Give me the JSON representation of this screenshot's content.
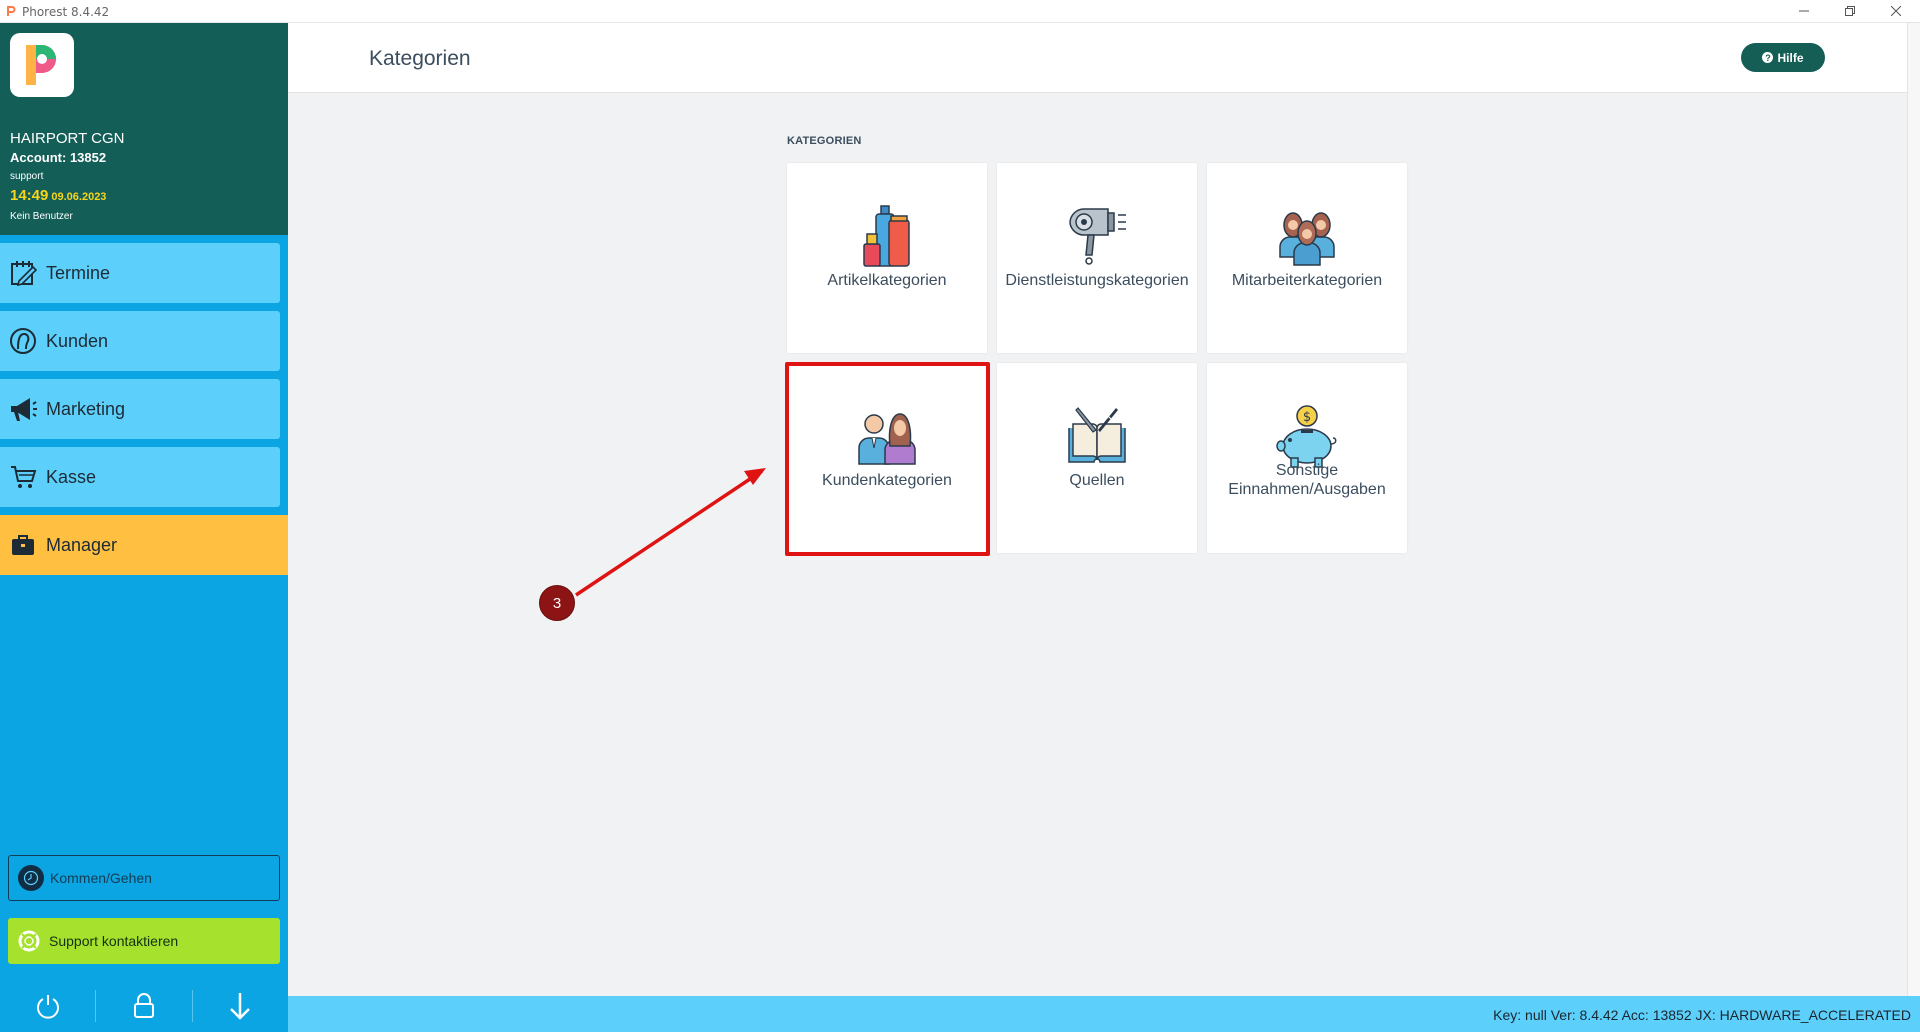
{
  "window": {
    "title": "Phorest 8.4.42",
    "controls": [
      "minimize",
      "restore",
      "close"
    ]
  },
  "sidebar": {
    "salon_name": "HAIRPORT CGN",
    "account": "Account: 13852",
    "user": "support",
    "time": "14:49",
    "date": "09.06.2023",
    "no_user": "Kein Benutzer",
    "nav": [
      {
        "label": "Termine",
        "icon": "calendar-edit-icon"
      },
      {
        "label": "Kunden",
        "icon": "client-head-icon"
      },
      {
        "label": "Marketing",
        "icon": "megaphone-icon"
      },
      {
        "label": "Kasse",
        "icon": "cart-icon"
      },
      {
        "label": "Manager",
        "icon": "briefcase-icon",
        "active": true
      }
    ],
    "kommen_gehen": "Kommen/Gehen",
    "support": "Support kontaktieren",
    "bottom_icons": [
      "power-icon",
      "lock-icon",
      "arrow-down-icon"
    ]
  },
  "header": {
    "title": "Kategorien",
    "help": "Hilfe"
  },
  "content": {
    "section_label": "KATEGORIEN",
    "cards": [
      {
        "label": "Artikelkategorien",
        "icon": "product-bottles-icon"
      },
      {
        "label": "Dienstleistungskategorien",
        "icon": "hairdryer-icon"
      },
      {
        "label": "Mitarbeiterkategorien",
        "icon": "staff-group-icon"
      },
      {
        "label": "Kundenkategorien",
        "icon": "customers-icon"
      },
      {
        "label": "Quellen",
        "icon": "book-pen-icon"
      },
      {
        "label": "Sonstige Einnahmen/Ausgaben",
        "icon": "piggy-bank-icon"
      }
    ]
  },
  "annotation": {
    "step": "3"
  },
  "status_bar": {
    "text": "Key: null Ver: 8.4.42 Acc: 13852  JX: HARDWARE_ACCELERATED"
  },
  "colors": {
    "sidebar_head": "#135e57",
    "sidebar": "#0aa5e2",
    "nav_item": "#5cd0fb",
    "nav_active": "#ffbf40",
    "support_button": "#a6e12d",
    "highlight": "#e01313"
  }
}
